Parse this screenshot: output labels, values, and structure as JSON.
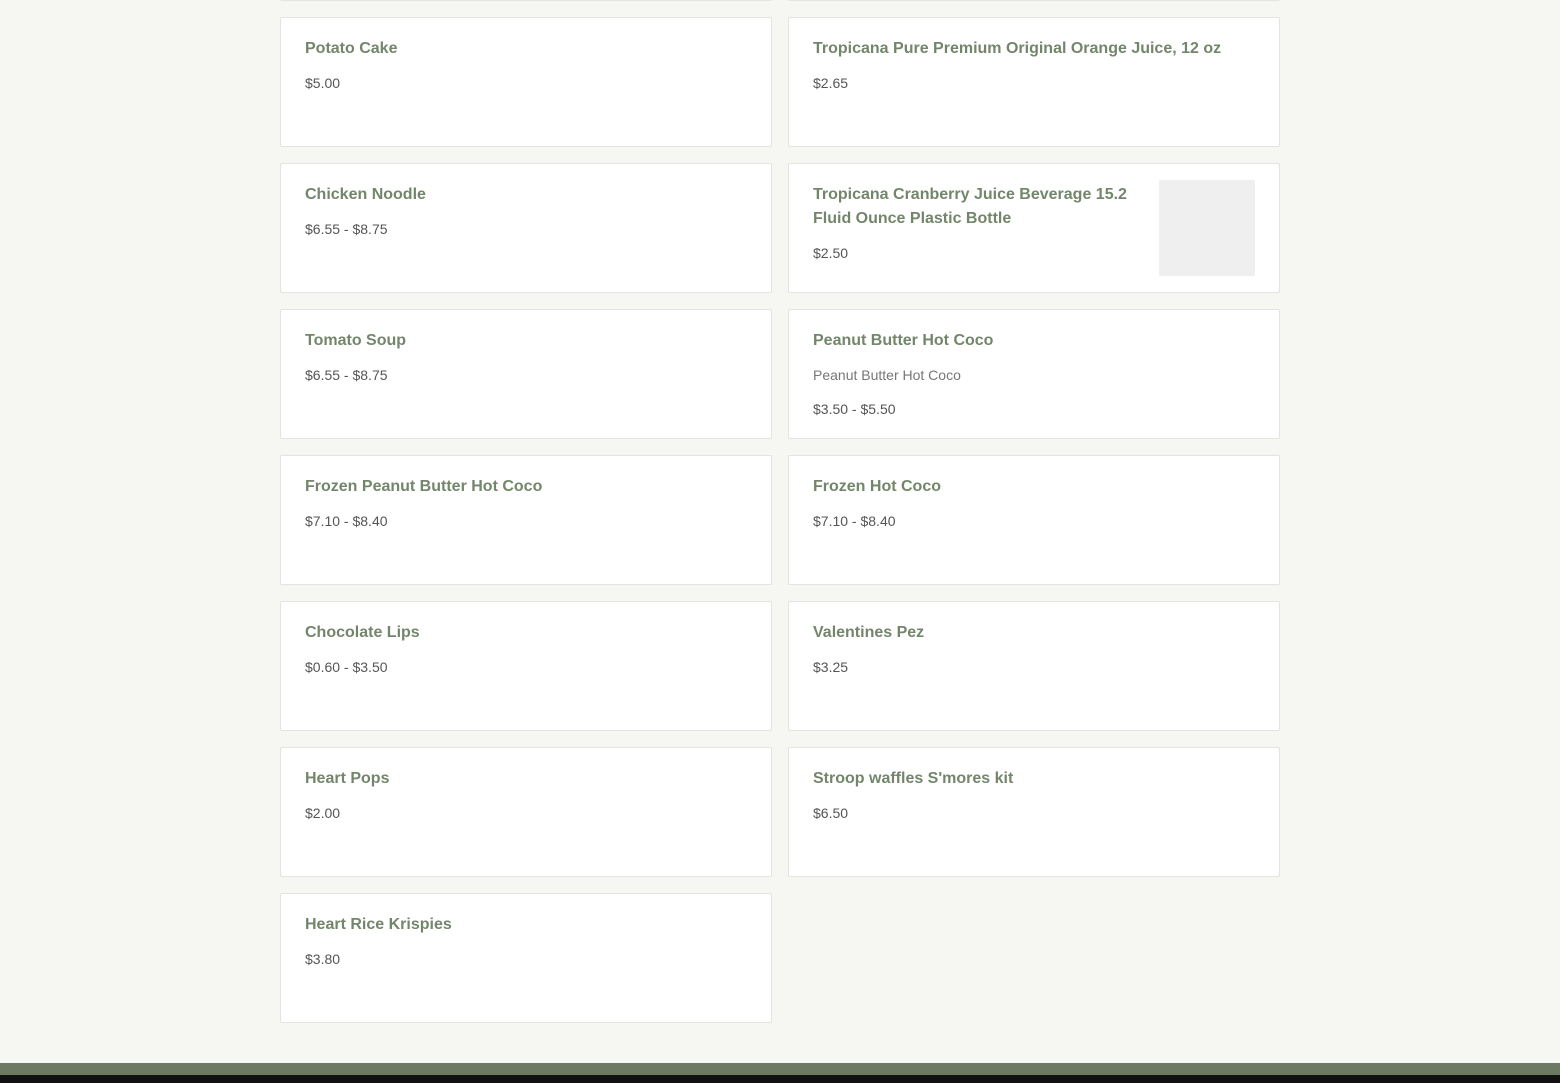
{
  "menu": {
    "items": [
      {
        "title": "",
        "price": ""
      },
      {
        "title": "",
        "price": ""
      },
      {
        "title": "Potato Cake",
        "price": "$5.00"
      },
      {
        "title": "Tropicana Pure Premium Original Orange Juice, 12 oz",
        "price": "$2.65"
      },
      {
        "title": "Chicken Noodle",
        "price": "$6.55 - $8.75"
      },
      {
        "title": "Tropicana Cranberry Juice Beverage 15.2 Fluid Ounce Plastic Bottle",
        "price": "$2.50",
        "has_image": true
      },
      {
        "title": "Tomato Soup",
        "price": "$6.55 - $8.75"
      },
      {
        "title": "Peanut Butter Hot Coco",
        "description": "Peanut Butter Hot Coco",
        "price": "$3.50 - $5.50"
      },
      {
        "title": "Frozen Peanut Butter Hot Coco",
        "price": "$7.10 - $8.40"
      },
      {
        "title": "Frozen Hot Coco",
        "price": "$7.10 - $8.40"
      },
      {
        "title": "Chocolate Lips",
        "price": "$0.60 - $3.50"
      },
      {
        "title": "Valentines Pez",
        "price": "$3.25"
      },
      {
        "title": "Heart Pops",
        "price": "$2.00"
      },
      {
        "title": "Stroop waffles S'mores kit",
        "price": "$6.50"
      },
      {
        "title": "Heart Rice Krispies",
        "price": "$3.80"
      }
    ]
  },
  "colors": {
    "background": "#f6f7f3",
    "card": "#ffffff",
    "title": "#73866b",
    "footer": "#6c7a64"
  }
}
